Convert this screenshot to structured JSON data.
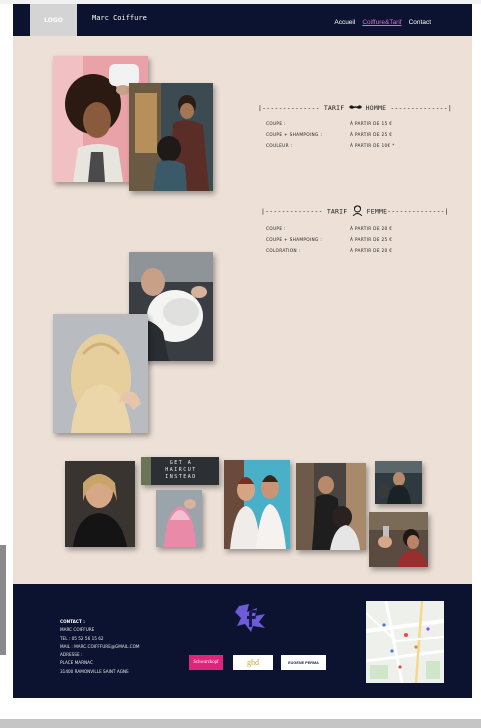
{
  "header": {
    "logo": "LOGO",
    "brand": "Marc Coiffure",
    "nav": [
      {
        "label": "Accueil",
        "active": false
      },
      {
        "label": "Coiffure&Tarif",
        "active": true
      },
      {
        "label": "Contact",
        "active": false
      }
    ]
  },
  "tarif_homme": {
    "title_left": "|-------------- TARIF",
    "title_right": "HOMME --------------|",
    "icon": "mustache-icon",
    "rows": [
      {
        "label": "COUPE :",
        "price": "À PARTIR DE 15 €"
      },
      {
        "label": "COUPE + SHAMPOING :",
        "price": "À PARTIR DE 25 €"
      },
      {
        "label": "COULEUR :",
        "price": "À PARTIR DE 10€ *"
      }
    ]
  },
  "tarif_femme": {
    "title_left": "|-------------- TARIF",
    "title_right": "FEMME--------------|",
    "icon": "woman-icon",
    "rows": [
      {
        "label": "COUPE :",
        "price": "À PARTIR DE 20 €"
      },
      {
        "label": "COUPE + SHAMPOING :",
        "price": "À PARTIR DE 25 €"
      },
      {
        "label": "COLORATION :",
        "price": "À PARTIR DE 20 €"
      }
    ]
  },
  "letterboard": {
    "line1": "GET A",
    "line2": "HAIRCUT",
    "line3": "INSTEAD"
  },
  "footer": {
    "contact_title": "CONTACT :",
    "contact_lines": [
      "MARC COIFFURE",
      "TEL : 05 52 56 15 62",
      "MAIL : MARC.COIFFFURE@GMAIL.COM",
      "ADRESSE :",
      "PLACE MARNAC",
      "31400 RAMONVILLE SAINT AGNE"
    ],
    "brands": [
      "Schwarzkopf",
      "ghd",
      "EUGENE PERMA"
    ]
  },
  "colors": {
    "navy": "#0b1330",
    "beige": "#ece0d7",
    "nav_active": "#d86fd0",
    "facebook": "#6d5bd8"
  }
}
